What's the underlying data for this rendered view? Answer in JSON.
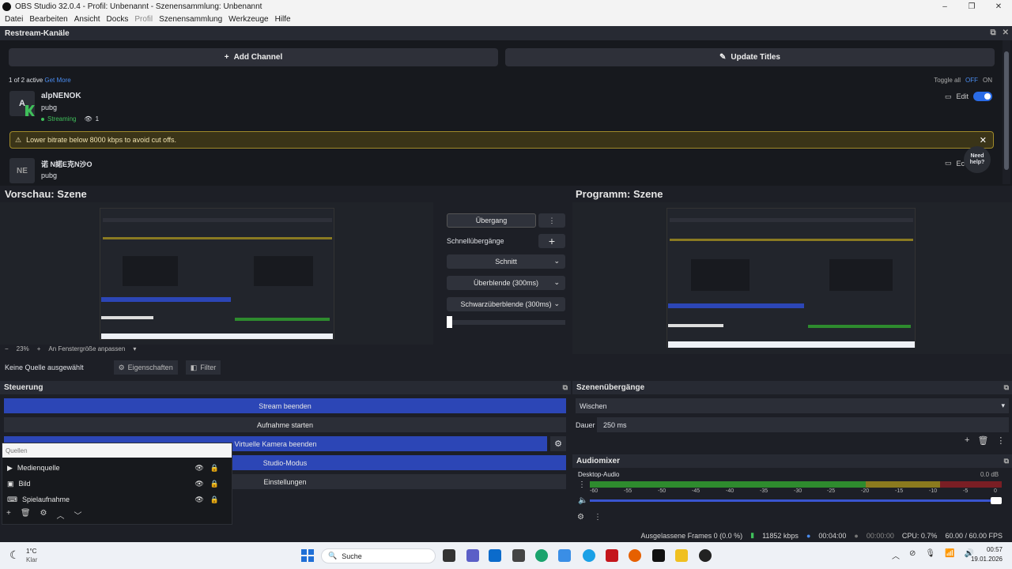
{
  "window": {
    "title": "OBS Studio 32.0.4 - Profil: Unbenannt - Szenensammlung: Unbenannt",
    "controls": [
      "–",
      "❐",
      "✕"
    ]
  },
  "menu": [
    "Datei",
    "Bearbeiten",
    "Ansicht",
    "Docks",
    "Profil",
    "Szenensammlung",
    "Werkzeuge",
    "Hilfe"
  ],
  "restream": {
    "title": "Restream-Kanäle",
    "add_channel": "Add Channel",
    "update_titles": "Update Titles",
    "active_count": "1 of 2 active",
    "get_more": "Get More",
    "toggle_all": "Toggle all",
    "off": "OFF",
    "on": "ON",
    "channels": [
      {
        "avatar": "A",
        "name": "alpNENOK",
        "game": "pubg",
        "status": "Streaming",
        "viewers": "1",
        "edit": "Edit",
        "enabled": true
      },
      {
        "avatar": "NE",
        "name": "诺 N諾E克N沙O",
        "game": "pubg",
        "edit": "Ec",
        "enabled": false
      }
    ],
    "warning": "Lower bitrate below 8000 kbps to avoid cut offs.",
    "need_help": "Need help?"
  },
  "preview": {
    "title": "Vorschau: Szene",
    "zoom": "23%",
    "fit": "An Fenstergröße anpassen"
  },
  "program": {
    "title": "Programm: Szene"
  },
  "transitions_center": {
    "uebergang": "Übergang",
    "quick_label": "Schnellübergänge",
    "items": [
      "Schnitt",
      "Überblende (300ms)",
      "Schwarzüberblende (300ms)"
    ]
  },
  "source_toolbar": {
    "no_source": "Keine Quelle ausgewählt",
    "properties": "Eigenschaften",
    "filter": "Filter"
  },
  "controls": {
    "title": "Steuerung",
    "buttons": [
      "Stream beenden",
      "Aufnahme starten",
      "Virtuelle Kamera beenden",
      "Studio-Modus",
      "Einstellungen"
    ]
  },
  "sources": {
    "title": "Quellen",
    "items": [
      "Medienquelle",
      "Bild",
      "Spielaufnahme"
    ]
  },
  "scene_transitions": {
    "title": "Szenenübergänge",
    "selected": "Wischen",
    "duration_label": "Dauer",
    "duration_value": "250 ms"
  },
  "audiomixer": {
    "title": "Audiomixer",
    "channel": "Desktop-Audio",
    "level": "0.0 dB",
    "ticks": [
      "-60",
      "-55",
      "-50",
      "-45",
      "-40",
      "-35",
      "-30",
      "-25",
      "-20",
      "-15",
      "-10",
      "-5",
      "0"
    ],
    "volume_fraction": 1.0
  },
  "status": {
    "dropped": "Ausgelassene Frames 0 (0.0 %)",
    "kbps": "11852 kbps",
    "stream_time": "00:04:00",
    "rec_time": "00:00:00",
    "cpu": "CPU: 0.7%",
    "fps": "60.00 / 60.00 FPS"
  },
  "taskbar": {
    "weather_temp": "1°C",
    "weather_desc": "Klar",
    "search": "Suche",
    "time": "00:57",
    "date": "19.01.2026"
  },
  "colors": {
    "accent_blue": "#2c46b6",
    "toggle_blue": "#2a6be6",
    "streaming_green": "#3fbf5a",
    "meter_green": "#2e8b2e",
    "meter_yellow": "#8b7a1e",
    "meter_red": "#7a1e24"
  }
}
